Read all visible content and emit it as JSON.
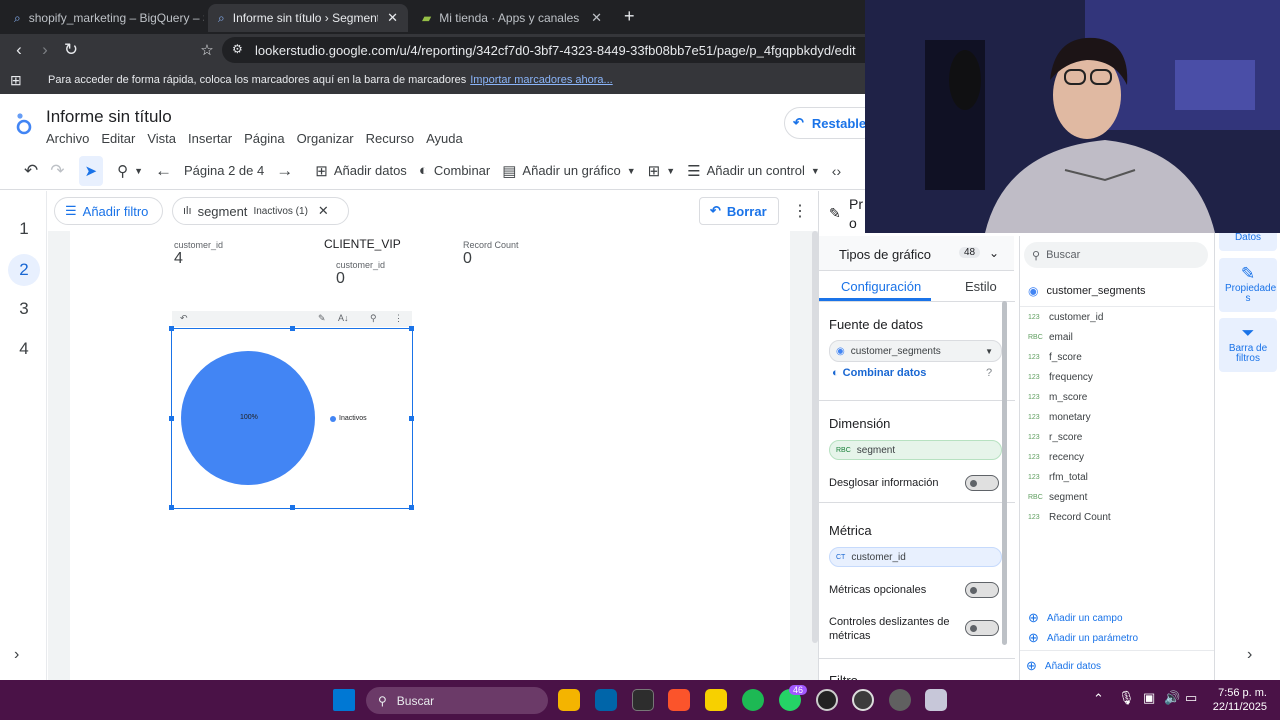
{
  "browser": {
    "tabs": [
      {
        "title": "shopify_marketing – BigQuery – Shop",
        "icon": "bigquery-icon"
      },
      {
        "title": "Informe sin título › Segmentació",
        "icon": "looker-studio-icon"
      },
      {
        "title": "Mi tienda · Apps y canales de venta ·",
        "icon": "shopify-icon"
      }
    ],
    "new_tab": "+",
    "close": "✕",
    "url": "lookerstudio.google.com/u/4/reporting/342cf7d0-3bf7-4323-8449-33fb08bb7e51/page/p_4fgqpbkdyd/edit",
    "bookmarks_text": "Para acceder de forma rápida, coloca los marcadores aquí en la barra de marcadores",
    "bookmarks_link": "Importar marcadores ahora..."
  },
  "app": {
    "title": "Informe sin título",
    "menus": [
      "Archivo",
      "Editar",
      "Vista",
      "Insertar",
      "Página",
      "Organizar",
      "Recurso",
      "Ayuda"
    ],
    "reset_button": "Restablece"
  },
  "toolbar": {
    "page_indicator": "Página 2 de 4",
    "add_data": "Añadir datos",
    "blend": "Combinar",
    "add_chart": "Añadir un gráfico",
    "add_control": "Añadir un control"
  },
  "pages": [
    "1",
    "2",
    "3",
    "4"
  ],
  "selected_page": "2",
  "filter_row": {
    "add_filter": "Añadir filtro",
    "segment_chip_name": "segment",
    "segment_chip_value": "Inactivos (1)",
    "clear": "Borrar"
  },
  "scorecards": [
    {
      "label": "customer_id",
      "value": "4"
    },
    {
      "label": "CLIENTE_VIP",
      "sublabel": "customer_id",
      "value": "0"
    },
    {
      "label": "Record Count",
      "value": "0"
    }
  ],
  "pie_chart": {
    "slice_label": "100%",
    "legend": "Inactivos",
    "color": "#4285f4"
  },
  "chart_data": {
    "type": "pie",
    "categories": [
      "Inactivos"
    ],
    "values": [
      100
    ],
    "title": ""
  },
  "properties_panel": {
    "header": "Pro cir",
    "chart_types_label": "Tipos de gráfico",
    "chart_types_count": "48",
    "tab_setup": "Configuración",
    "tab_style": "Estilo",
    "data_source_title": "Fuente de datos",
    "data_source": "customer_segments",
    "blend_data": "Combinar datos",
    "dimension_title": "Dimensión",
    "dimension_type": "RBC",
    "dimension": "segment",
    "drill_down": "Desglosar información",
    "metric_title": "Métrica",
    "metric_type": "CT",
    "metric": "customer_id",
    "optional_metrics": "Métricas opcionales",
    "slider_controls": "Controles deslizantes de métricas",
    "filter_title": "Filtro"
  },
  "fields_panel": {
    "search_placeholder": "Buscar",
    "source": "customer_segments",
    "fields": [
      {
        "type": "123",
        "name": "customer_id"
      },
      {
        "type": "RBC",
        "name": "email"
      },
      {
        "type": "123",
        "name": "f_score"
      },
      {
        "type": "123",
        "name": "frequency"
      },
      {
        "type": "123",
        "name": "m_score"
      },
      {
        "type": "123",
        "name": "monetary"
      },
      {
        "type": "123",
        "name": "r_score"
      },
      {
        "type": "123",
        "name": "recency"
      },
      {
        "type": "123",
        "name": "rfm_total"
      },
      {
        "type": "RBC",
        "name": "segment"
      },
      {
        "type": "123",
        "name": "Record Count"
      }
    ],
    "add_field": "Añadir un campo",
    "add_parameter": "Añadir un parámetro",
    "add_data": "Añadir datos"
  },
  "rail": {
    "data": "Datos",
    "properties": "Propiedade s",
    "filter_bar": "Barra de filtros"
  },
  "taskbar": {
    "search": "Buscar",
    "whatsapp_badge": "46",
    "time": "7:56 p. m.",
    "date": "22/11/2025"
  }
}
